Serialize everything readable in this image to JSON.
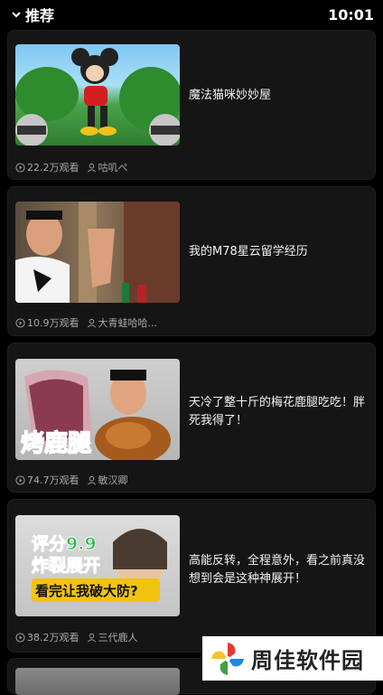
{
  "header": {
    "title": "推荐",
    "time": "10:01"
  },
  "cards": [
    {
      "title": "魔法猫咪妙妙屋",
      "views": "22.2万观看",
      "author": "咕叽ぺ"
    },
    {
      "title": "我的M78星云留学经历",
      "views": "10.9万观看",
      "author": "大青蛙哈哈..."
    },
    {
      "title": "天冷了整十斤的梅花鹿腿吃吃！胖死我得了！",
      "views": "74.7万观看",
      "author": "敏汉卿",
      "thumb_caption": "烤鹿腿"
    },
    {
      "title": "高能反转，全程意外，看之前真没想到会是这种神展开！",
      "views": "38.2万观看",
      "author": "三代鹿人",
      "thumb_line1": "评分9.9",
      "thumb_line2": "炸裂展开",
      "thumb_line3": "看完让我破大防?"
    }
  ],
  "watermark": {
    "text": "周佳软件园"
  }
}
